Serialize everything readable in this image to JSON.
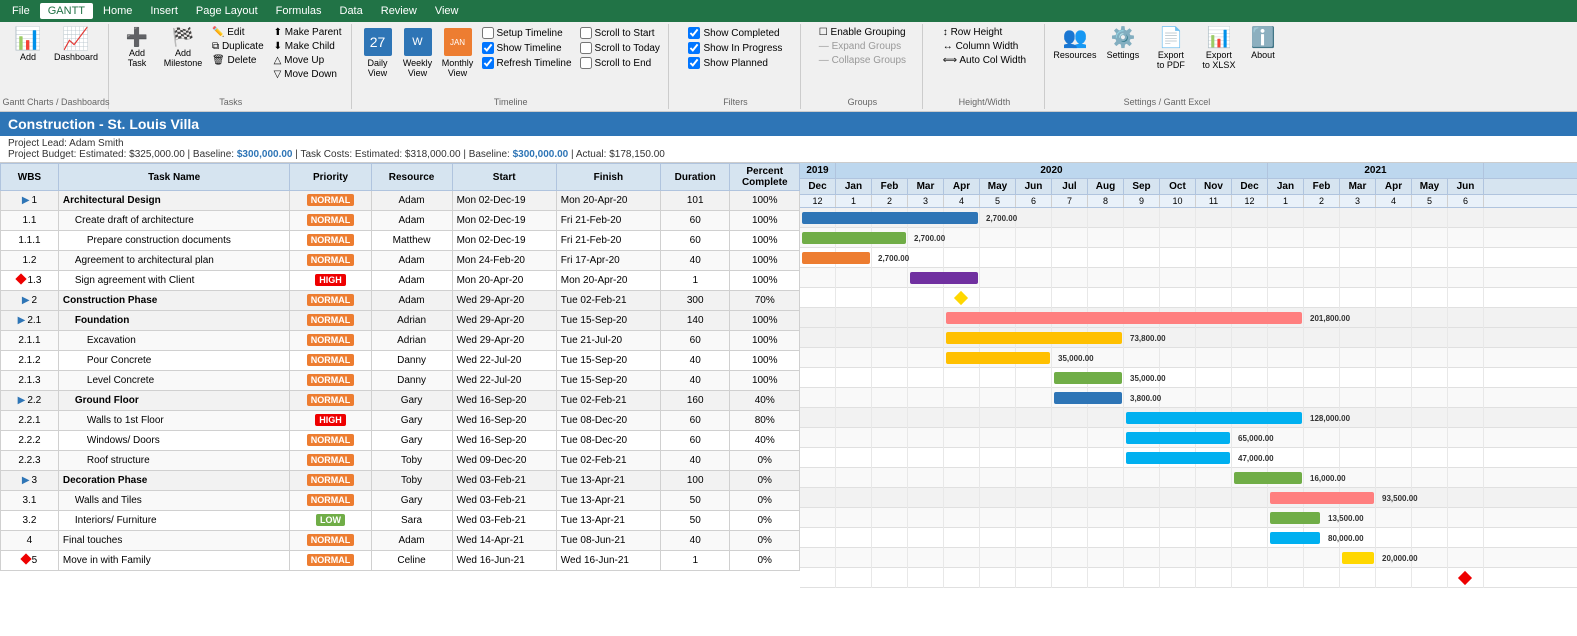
{
  "app": {
    "title": "Construction - St. Louis Villa"
  },
  "menubar": {
    "items": [
      "File",
      "GANTT",
      "Home",
      "Insert",
      "Page Layout",
      "Formulas",
      "Data",
      "Review",
      "View"
    ]
  },
  "ribbon": {
    "groups": [
      {
        "label": "Gantt Charts",
        "items": [
          {
            "icon": "📊",
            "label": "Add\nGantt Charts"
          }
        ]
      },
      {
        "label": "Dashboards",
        "items": [
          {
            "icon": "📈",
            "label": "Dashboard"
          }
        ]
      },
      {
        "label": "Tasks",
        "large": [
          {
            "icon": "➕",
            "label": "Add\nTask"
          },
          {
            "icon": "🏁",
            "label": "Add\nMilestone"
          }
        ],
        "small": [
          "Edit",
          "Duplicate",
          "Delete",
          "Make Parent",
          "Make Child",
          "Move Up",
          "Move Down"
        ]
      },
      {
        "label": "Timeline",
        "views": [
          "Daily View",
          "Weekly View",
          "Monthly View"
        ],
        "checks": [
          "Setup Timeline",
          "Show Timeline",
          "Refresh Timeline",
          "Scroll to Start",
          "Scroll to Today",
          "Scroll to End"
        ]
      },
      {
        "label": "Filters",
        "checks": [
          "Show Completed",
          "Show In Progress",
          "Show Planned"
        ]
      },
      {
        "label": "Groups",
        "items": [
          "Enable Grouping",
          "Expand Groups",
          "Collapse Groups"
        ]
      },
      {
        "label": "Height/Width",
        "items": [
          "Row Height",
          "Column Width",
          "Auto Col Width"
        ]
      },
      {
        "label": "Settings",
        "items": [
          "Resources",
          "Settings",
          "Export to PDF",
          "Export to XLSX",
          "About"
        ]
      }
    ]
  },
  "project": {
    "title": "Construction - St. Louis Villa",
    "lead": "Project Lead: Adam Smith",
    "budget": "Project Budget: Estimated: $325,000.00 | Baseline: $300,000.00 | Task Costs: Estimated: $318,000.00 | Baseline: $300,000.00 | Actual: $178,150.00"
  },
  "table": {
    "headers": [
      "WBS",
      "Task Name",
      "Priority",
      "Resource",
      "Start",
      "Finish",
      "Duration",
      "Percent\nComplete"
    ],
    "rows": [
      {
        "wbs": "1",
        "task": "Architectural Design",
        "indent": 0,
        "group": true,
        "priority": "NORMAL",
        "resource": "Adam",
        "start": "Mon 02-Dec-19",
        "finish": "Mon 20-Apr-20",
        "duration": "101",
        "percent": "100%",
        "expand": true
      },
      {
        "wbs": "1.1",
        "task": "Create draft of architecture",
        "indent": 1,
        "group": false,
        "priority": "NORMAL",
        "resource": "Adam",
        "start": "Mon 02-Dec-19",
        "finish": "Fri 21-Feb-20",
        "duration": "60",
        "percent": "100%"
      },
      {
        "wbs": "1.1.1",
        "task": "Prepare construction documents",
        "indent": 2,
        "group": false,
        "priority": "NORMAL",
        "resource": "Matthew",
        "start": "Mon 02-Dec-19",
        "finish": "Fri 21-Feb-20",
        "duration": "60",
        "percent": "100%"
      },
      {
        "wbs": "1.2",
        "task": "Agreement to architectural plan",
        "indent": 1,
        "group": false,
        "priority": "NORMAL",
        "resource": "Adam",
        "start": "Mon 24-Feb-20",
        "finish": "Fri 17-Apr-20",
        "duration": "40",
        "percent": "100%"
      },
      {
        "wbs": "1.3",
        "task": "Sign agreement with Client",
        "indent": 1,
        "group": false,
        "priority": "HIGH",
        "resource": "Adam",
        "start": "Mon 20-Apr-20",
        "finish": "Mon 20-Apr-20",
        "duration": "1",
        "percent": "100%",
        "milestone": true
      },
      {
        "wbs": "2",
        "task": "Construction Phase",
        "indent": 0,
        "group": true,
        "priority": "NORMAL",
        "resource": "Adam",
        "start": "Wed 29-Apr-20",
        "finish": "Tue 02-Feb-21",
        "duration": "300",
        "percent": "70%",
        "expand": true
      },
      {
        "wbs": "2.1",
        "task": "Foundation",
        "indent": 1,
        "group": true,
        "priority": "NORMAL",
        "resource": "Adrian",
        "start": "Wed 29-Apr-20",
        "finish": "Tue 15-Sep-20",
        "duration": "140",
        "percent": "100%",
        "expand": true
      },
      {
        "wbs": "2.1.1",
        "task": "Excavation",
        "indent": 2,
        "group": false,
        "priority": "NORMAL",
        "resource": "Adrian",
        "start": "Wed 29-Apr-20",
        "finish": "Tue 21-Jul-20",
        "duration": "60",
        "percent": "100%"
      },
      {
        "wbs": "2.1.2",
        "task": "Pour Concrete",
        "indent": 2,
        "group": false,
        "priority": "NORMAL",
        "resource": "Danny",
        "start": "Wed 22-Jul-20",
        "finish": "Tue 15-Sep-20",
        "duration": "40",
        "percent": "100%"
      },
      {
        "wbs": "2.1.3",
        "task": "Level Concrete",
        "indent": 2,
        "group": false,
        "priority": "NORMAL",
        "resource": "Danny",
        "start": "Wed 22-Jul-20",
        "finish": "Tue 15-Sep-20",
        "duration": "40",
        "percent": "100%"
      },
      {
        "wbs": "2.2",
        "task": "Ground Floor",
        "indent": 1,
        "group": true,
        "priority": "NORMAL",
        "resource": "Gary",
        "start": "Wed 16-Sep-20",
        "finish": "Tue 02-Feb-21",
        "duration": "160",
        "percent": "40%",
        "expand": true
      },
      {
        "wbs": "2.2.1",
        "task": "Walls to 1st Floor",
        "indent": 2,
        "group": false,
        "priority": "HIGH",
        "resource": "Gary",
        "start": "Wed 16-Sep-20",
        "finish": "Tue 08-Dec-20",
        "duration": "60",
        "percent": "80%"
      },
      {
        "wbs": "2.2.2",
        "task": "Windows/ Doors",
        "indent": 2,
        "group": false,
        "priority": "NORMAL",
        "resource": "Gary",
        "start": "Wed 16-Sep-20",
        "finish": "Tue 08-Dec-20",
        "duration": "60",
        "percent": "40%"
      },
      {
        "wbs": "2.2.3",
        "task": "Roof structure",
        "indent": 2,
        "group": false,
        "priority": "NORMAL",
        "resource": "Toby",
        "start": "Wed 09-Dec-20",
        "finish": "Tue 02-Feb-21",
        "duration": "40",
        "percent": "0%"
      },
      {
        "wbs": "3",
        "task": "Decoration Phase",
        "indent": 0,
        "group": true,
        "priority": "NORMAL",
        "resource": "Toby",
        "start": "Wed 03-Feb-21",
        "finish": "Tue 13-Apr-21",
        "duration": "100",
        "percent": "0%",
        "expand": true
      },
      {
        "wbs": "3.1",
        "task": "Walls and Tiles",
        "indent": 1,
        "group": false,
        "priority": "NORMAL",
        "resource": "Gary",
        "start": "Wed 03-Feb-21",
        "finish": "Tue 13-Apr-21",
        "duration": "50",
        "percent": "0%"
      },
      {
        "wbs": "3.2",
        "task": "Interiors/ Furniture",
        "indent": 1,
        "group": false,
        "priority": "LOW",
        "resource": "Sara",
        "start": "Wed 03-Feb-21",
        "finish": "Tue 13-Apr-21",
        "duration": "50",
        "percent": "0%"
      },
      {
        "wbs": "4",
        "task": "Final touches",
        "indent": 0,
        "group": false,
        "priority": "NORMAL",
        "resource": "Adam",
        "start": "Wed 14-Apr-21",
        "finish": "Tue 08-Jun-21",
        "duration": "40",
        "percent": "0%"
      },
      {
        "wbs": "5",
        "task": "Move in with Family",
        "indent": 0,
        "group": false,
        "priority": "NORMAL",
        "resource": "Celine",
        "start": "Wed 16-Jun-21",
        "finish": "Wed 16-Jun-21",
        "duration": "1",
        "percent": "0%",
        "milestone": true
      }
    ]
  },
  "gantt": {
    "years": [
      {
        "label": "2019",
        "span": 1
      },
      {
        "label": "2020",
        "span": 12
      },
      {
        "label": "2021",
        "span": 6
      }
    ],
    "months": [
      "Dec",
      "Jan",
      "Feb",
      "Mar",
      "Apr",
      "May",
      "Jun",
      "Jul",
      "Aug",
      "Sep",
      "Oct",
      "Nov",
      "Dec",
      "Jan",
      "Feb",
      "Mar",
      "Apr",
      "May",
      "Jun"
    ],
    "weeks": [
      "12",
      "1",
      "2",
      "3",
      "4",
      "5",
      "6",
      "7",
      "8",
      "9",
      "10",
      "11",
      "12",
      "1",
      "2",
      "3",
      "4",
      "5",
      "6"
    ],
    "bars": [
      {
        "row": 0,
        "start": 0,
        "width": 5,
        "color": "#2e75b6",
        "label": "2,700.00",
        "arrow": true
      },
      {
        "row": 1,
        "start": 0,
        "width": 3,
        "color": "#70ad47",
        "label": "2,700.00"
      },
      {
        "row": 2,
        "start": 0,
        "width": 2,
        "color": "#ed7d31",
        "label": "2,700.00"
      },
      {
        "row": 3,
        "start": 3,
        "width": 2,
        "color": "#7030a0",
        "label": ""
      },
      {
        "row": 4,
        "start": 4,
        "width": 0.2,
        "color": "#ffd700",
        "label": "",
        "diamond": true
      },
      {
        "row": 5,
        "start": 4,
        "width": 10,
        "color": "#ff7f7f",
        "label": "201,800.00"
      },
      {
        "row": 6,
        "start": 4,
        "width": 5,
        "color": "#ffc000",
        "label": "73,800.00"
      },
      {
        "row": 7,
        "start": 4,
        "width": 3,
        "color": "#ffc000",
        "label": "35,000.00"
      },
      {
        "row": 8,
        "start": 7,
        "width": 2,
        "color": "#70ad47",
        "label": "35,000.00"
      },
      {
        "row": 9,
        "start": 7,
        "width": 2,
        "color": "#2e75b6",
        "label": "3,800.00"
      },
      {
        "row": 10,
        "start": 9,
        "width": 5,
        "color": "#00b0f0",
        "label": "128,000.00"
      },
      {
        "row": 11,
        "start": 9,
        "width": 3,
        "color": "#00b0f0",
        "label": "65,000.00"
      },
      {
        "row": 12,
        "start": 9,
        "width": 3,
        "color": "#00b0f0",
        "label": "47,000.00"
      },
      {
        "row": 13,
        "start": 12,
        "width": 2,
        "color": "#70ad47",
        "label": "16,000.00"
      },
      {
        "row": 14,
        "start": 13,
        "width": 3,
        "color": "#ff7f7f",
        "label": "93,500.00"
      },
      {
        "row": 15,
        "start": 13,
        "width": 1.5,
        "color": "#70ad47",
        "label": "13,500.00"
      },
      {
        "row": 16,
        "start": 13,
        "width": 1.5,
        "color": "#00b0f0",
        "label": "80,000.00"
      },
      {
        "row": 17,
        "start": 15,
        "width": 1,
        "color": "#ffd700",
        "label": "20,000.00"
      },
      {
        "row": 18,
        "start": 18,
        "width": 0.2,
        "color": "#e00",
        "label": "",
        "diamond": true
      }
    ]
  }
}
